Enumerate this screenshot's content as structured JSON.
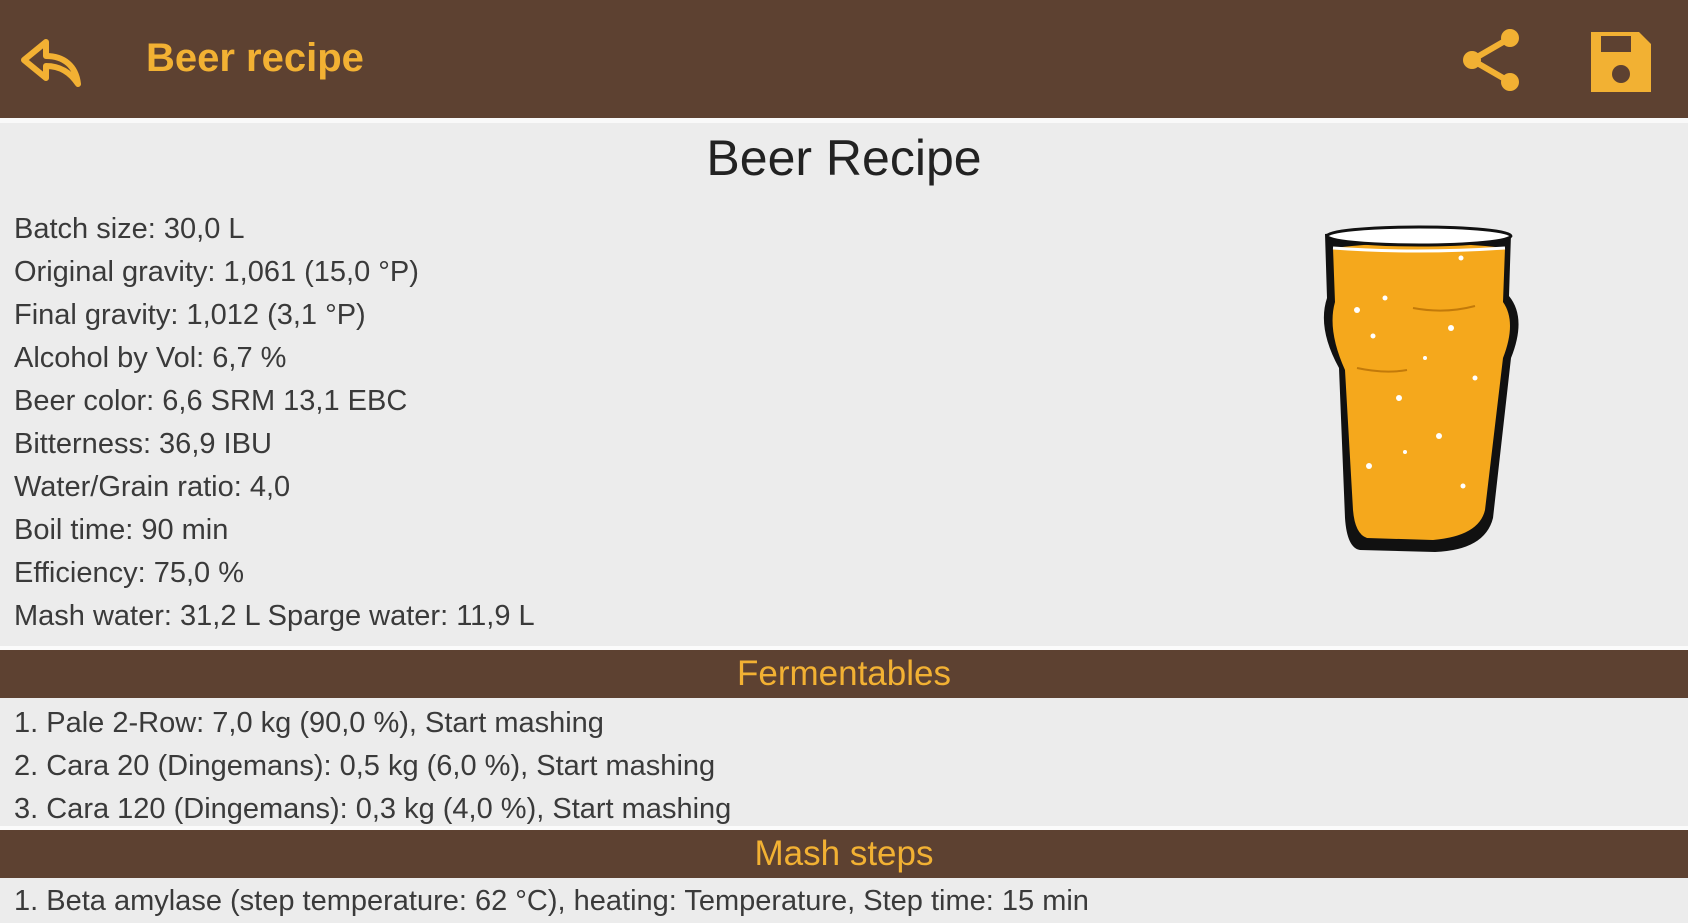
{
  "appbar": {
    "title": "Beer recipe",
    "back_icon": "reply-arrow-icon",
    "share_icon": "share-icon",
    "save_icon": "floppy-disk-icon",
    "background_color": "#5d4131",
    "accent_color": "#f2b133"
  },
  "recipe": {
    "heading": "Beer Recipe",
    "info": [
      "Batch size: 30,0 L",
      "Original gravity: 1,061 (15,0 °P)",
      "Final gravity: 1,012 (3,1 °P)",
      "Alcohol by Vol: 6,7 %",
      "Beer color: 6,6 SRM 13,1 EBC",
      "Bitterness: 36,9 IBU",
      "Water/Grain ratio: 4,0",
      "Boil time: 90 min",
      "Efficiency: 75,0 %",
      "Mash water: 31,2 L  Sparge water: 11,9 L"
    ],
    "image_icon": "beer-glass-icon",
    "beer_color": "#f5a81c"
  },
  "fermentables": {
    "header": "Fermentables",
    "items": [
      "1. Pale 2-Row: 7,0 kg (90,0 %), Start mashing",
      "2. Cara 20 (Dingemans): 0,5 kg (6,0 %), Start mashing",
      "3. Cara 120 (Dingemans): 0,3 kg (4,0 %), Start mashing"
    ]
  },
  "mash_steps": {
    "header": "Mash steps",
    "items": [
      "1. Beta amylase (step temperature: 62 °C), heating: Temperature, Step time: 15 min"
    ]
  }
}
